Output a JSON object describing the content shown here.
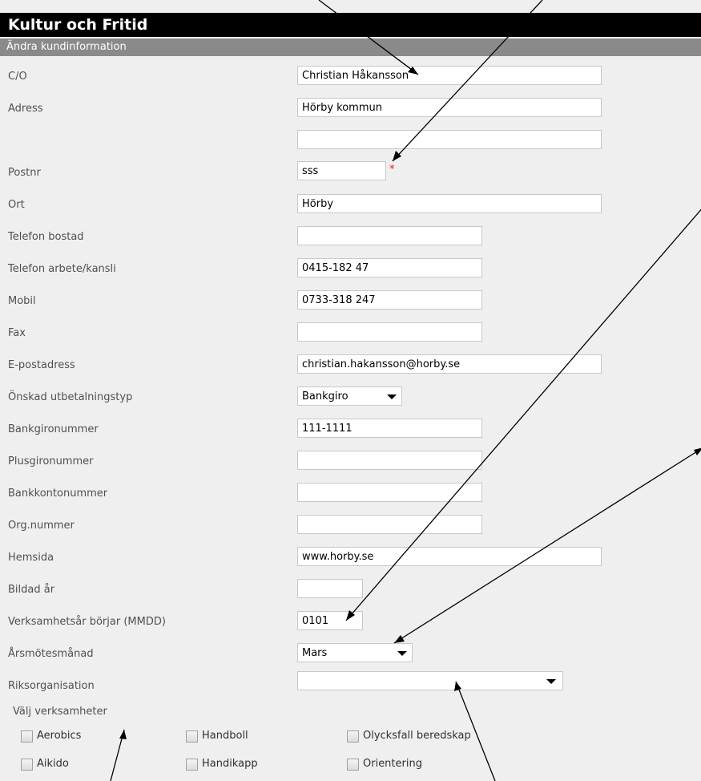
{
  "header": {
    "title": "Kultur och Fritid",
    "subtitle": "Ändra kundinformation"
  },
  "fields": {
    "co": {
      "label": "C/O",
      "value": "Christian Håkansson"
    },
    "adress": {
      "label": "Adress",
      "value": "Hörby kommun"
    },
    "adress2": {
      "label": "",
      "value": ""
    },
    "postnr": {
      "label": "Postnr",
      "value": "sss",
      "required_mark": "*"
    },
    "ort": {
      "label": "Ort",
      "value": "Hörby"
    },
    "telefon_bostad": {
      "label": "Telefon bostad",
      "value": ""
    },
    "telefon_arbete": {
      "label": "Telefon arbete/kansli",
      "value": "0415-182 47"
    },
    "mobil": {
      "label": "Mobil",
      "value": "0733-318 247"
    },
    "fax": {
      "label": "Fax",
      "value": ""
    },
    "epost": {
      "label": "E-postadress",
      "value": "christian.hakansson@horby.se"
    },
    "utbetalningstyp": {
      "label": "Önskad utbetalningstyp",
      "value": "Bankgiro"
    },
    "bankgiro": {
      "label": "Bankgironummer",
      "value": "111-1111"
    },
    "plusgiro": {
      "label": "Plusgironummer",
      "value": ""
    },
    "bankkonto": {
      "label": "Bankkontonummer",
      "value": ""
    },
    "orgnummer": {
      "label": "Org.nummer",
      "value": ""
    },
    "hemsida": {
      "label": "Hemsida",
      "value": "www.horby.se"
    },
    "bildad": {
      "label": "Bildad år",
      "value": ""
    },
    "verksamhetsar": {
      "label": "Verksamhetsår börjar (MMDD)",
      "value": "0101"
    },
    "arsmotesmanad": {
      "label": "Årsmötesmånad",
      "value": "Mars"
    },
    "riksorganisation": {
      "label": "Riksorganisation",
      "value": ""
    }
  },
  "verksamheter": {
    "label": "Välj verksamheter",
    "items": [
      {
        "label": "Aerobics",
        "checked": false
      },
      {
        "label": "Handboll",
        "checked": false
      },
      {
        "label": "Olycksfall beredskap",
        "checked": false
      },
      {
        "label": "Aikido",
        "checked": false
      },
      {
        "label": "Handikapp",
        "checked": false
      },
      {
        "label": "Orientering",
        "checked": false
      }
    ]
  },
  "colors": {
    "title_bg": "#000000",
    "subtitle_bg": "#8a8a8a",
    "form_bg": "#efefef",
    "required": "#e02020"
  }
}
